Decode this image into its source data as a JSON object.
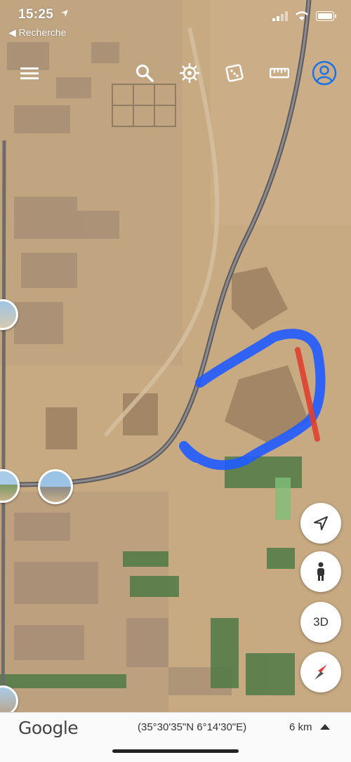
{
  "status_bar": {
    "time": "15:25",
    "back_label": "◀ Recherche"
  },
  "toolbar": {
    "items": [
      {
        "name": "menu-icon"
      },
      {
        "name": "search-icon"
      },
      {
        "name": "voyager-icon"
      },
      {
        "name": "dice-icon"
      },
      {
        "name": "ruler-icon"
      },
      {
        "name": "account-icon"
      }
    ]
  },
  "side_buttons": {
    "three_d_label": "3D"
  },
  "footer": {
    "brand": "Google",
    "coordinates": "(35°30'35\"N 6°14'30\"E)",
    "scale": "6 km"
  },
  "colors": {
    "annotation_blue": "#1f5bff",
    "annotation_red": "#e0402f",
    "account_blue": "#1a73e8",
    "compass_red": "#e53935"
  }
}
